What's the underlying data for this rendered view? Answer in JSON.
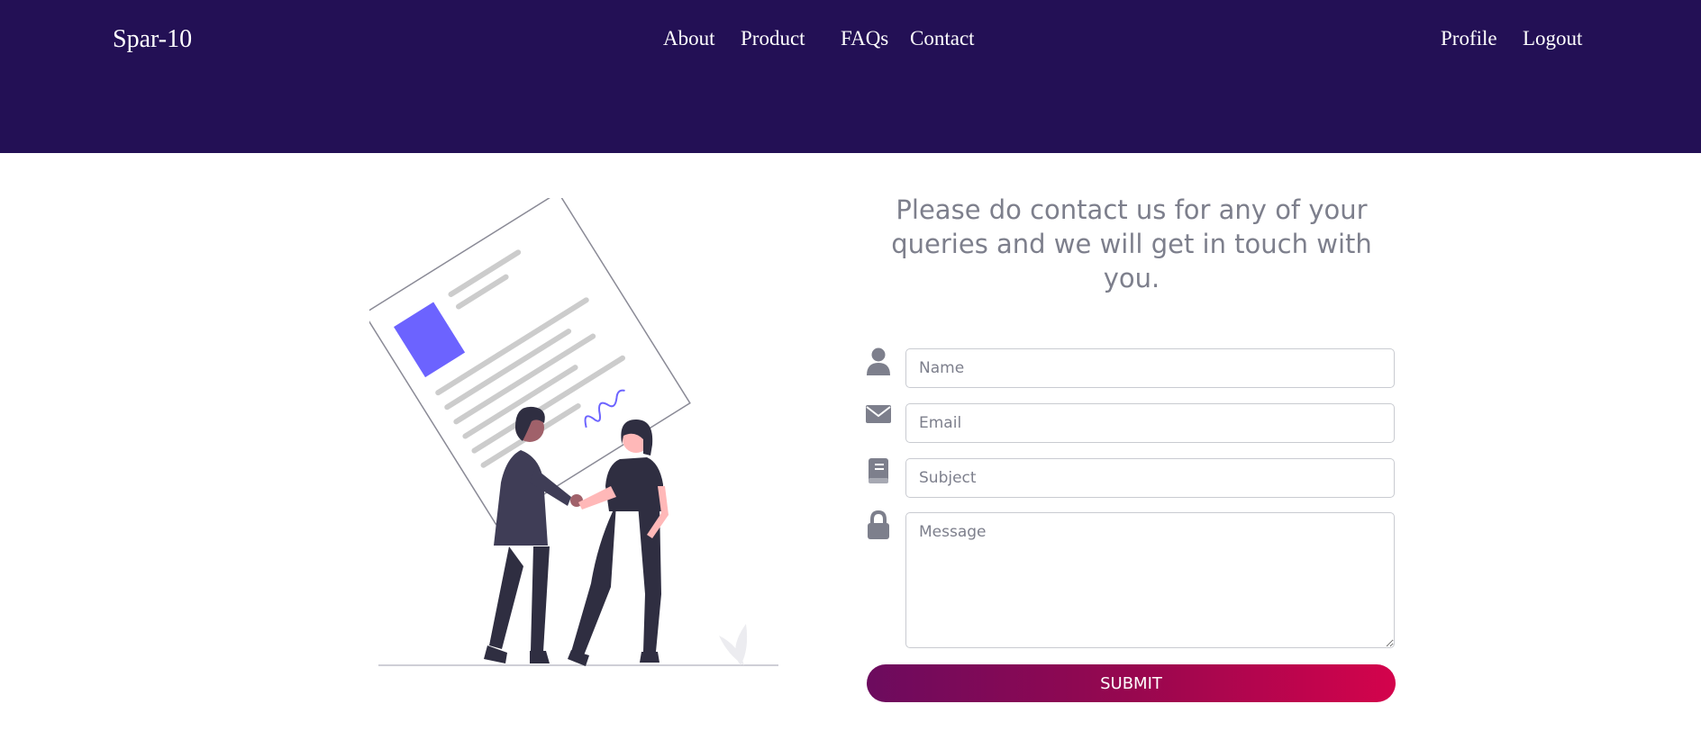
{
  "navbar": {
    "brand": "Spar-10",
    "links": [
      {
        "label": "About"
      },
      {
        "label": "Product"
      },
      {
        "label": "FAQs"
      },
      {
        "label": "Contact"
      }
    ],
    "account_links": [
      {
        "label": "Profile"
      },
      {
        "label": "Logout"
      }
    ]
  },
  "contact": {
    "heading": "Please do contact us for any of your queries and we will get in touch with you.",
    "fields": {
      "name": {
        "placeholder": "Name",
        "value": "",
        "icon": "user-icon"
      },
      "email": {
        "placeholder": "Email",
        "value": "",
        "icon": "envelope-icon"
      },
      "subject": {
        "placeholder": "Subject",
        "value": "",
        "icon": "book-icon"
      },
      "message": {
        "placeholder": "Message",
        "value": "",
        "icon": "lock-icon"
      }
    },
    "submit_label": "SUBMIT"
  },
  "colors": {
    "navbar_bg": "#231055",
    "icon_gray": "#7d7f8c",
    "accent_purple": "#6c63ff",
    "submit_gradient_start": "#6c0b5e",
    "submit_gradient_end": "#d4034c"
  }
}
